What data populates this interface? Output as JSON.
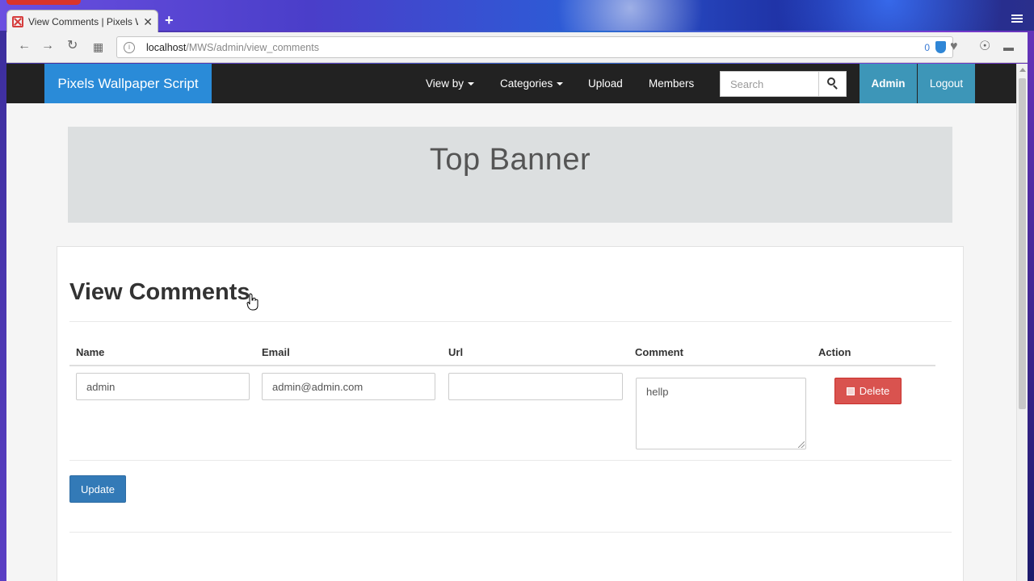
{
  "browser": {
    "tab_title": "View Comments | Pixels W",
    "tab_close": "✕",
    "new_tab": "+",
    "address_host": "localhost",
    "address_path": "/MWS/admin/view_comments",
    "address_badge_count": "0",
    "nav_icons": [
      "back-icon",
      "forward-icon",
      "reload-icon",
      "apps-grid-icon"
    ],
    "toolbar_icons": [
      "heart-icon",
      "download-icon",
      "battery-icon"
    ]
  },
  "navbar": {
    "brand": "Pixels Wallpaper Script",
    "view_by": "View by",
    "categories": "Categories",
    "upload": "Upload",
    "members": "Members",
    "search_placeholder": "Search",
    "admin": "Admin",
    "logout": "Logout"
  },
  "banner": {
    "text": "Top Banner"
  },
  "panel": {
    "title": "View Comments",
    "columns": [
      "Name",
      "Email",
      "Url",
      "Comment",
      "Action"
    ],
    "rows": [
      {
        "name": "admin",
        "email": "admin@admin.com",
        "url": "",
        "comment": "hellp",
        "action_label": "Delete"
      }
    ],
    "update_label": "Update"
  },
  "colors": {
    "brand_blue": "#2a8bd8",
    "navbar_bg": "#222222",
    "admin_teal": "#3d96b8",
    "delete_red": "#d9534f",
    "update_blue": "#337ab7"
  }
}
